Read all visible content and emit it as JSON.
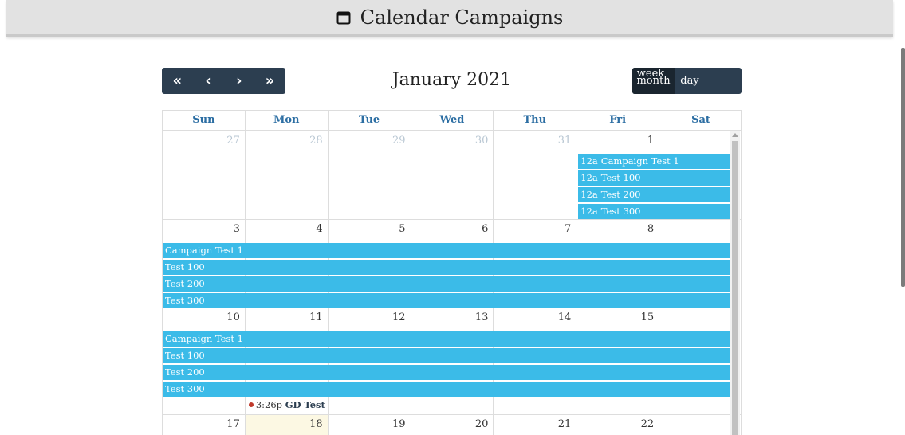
{
  "header": {
    "title": "Calendar Campaigns",
    "icon": "calendar-icon"
  },
  "toolbar": {
    "nav": [
      {
        "label": "«",
        "name": "prev-year-button"
      },
      {
        "label": "‹",
        "name": "prev-month-button"
      },
      {
        "label": "›",
        "name": "next-month-button"
      },
      {
        "label": "»",
        "name": "next-year-button"
      }
    ],
    "title": "January 2021",
    "views": [
      {
        "label": "month",
        "name": "month-view-button",
        "active": true
      },
      {
        "label": "week",
        "name": "week-view-button",
        "active": false
      },
      {
        "label": "day",
        "name": "day-view-button",
        "active": false
      }
    ]
  },
  "calendar": {
    "weekdays": [
      "Sun",
      "Mon",
      "Tue",
      "Wed",
      "Thu",
      "Fri",
      "Sat"
    ],
    "weeks": [
      {
        "days": [
          {
            "num": "27",
            "other": true
          },
          {
            "num": "28",
            "other": true
          },
          {
            "num": "29",
            "other": true
          },
          {
            "num": "30",
            "other": true
          },
          {
            "num": "31",
            "other": true
          },
          {
            "num": "1",
            "other": false
          },
          {
            "num": "",
            "other": false
          }
        ],
        "events": [
          {
            "time": "12a",
            "title": "Campaign Test 1",
            "startCol": 5,
            "span": 2
          },
          {
            "time": "12a",
            "title": "Test 100",
            "startCol": 5,
            "span": 2
          },
          {
            "time": "12a",
            "title": "Test 200",
            "startCol": 5,
            "span": 2
          },
          {
            "time": "12a",
            "title": "Test 300",
            "startCol": 5,
            "span": 2
          }
        ],
        "dotEvents": []
      },
      {
        "days": [
          {
            "num": "3",
            "other": false
          },
          {
            "num": "4",
            "other": false
          },
          {
            "num": "5",
            "other": false
          },
          {
            "num": "6",
            "other": false
          },
          {
            "num": "7",
            "other": false
          },
          {
            "num": "8",
            "other": false
          },
          {
            "num": "",
            "other": false
          }
        ],
        "events": [
          {
            "time": "",
            "title": "Campaign Test 1",
            "startCol": 0,
            "span": 7
          },
          {
            "time": "",
            "title": "Test 100",
            "startCol": 0,
            "span": 7
          },
          {
            "time": "",
            "title": "Test 200",
            "startCol": 0,
            "span": 7
          },
          {
            "time": "",
            "title": "Test 300",
            "startCol": 0,
            "span": 7
          }
        ],
        "dotEvents": []
      },
      {
        "days": [
          {
            "num": "10",
            "other": false
          },
          {
            "num": "11",
            "other": false
          },
          {
            "num": "12",
            "other": false
          },
          {
            "num": "13",
            "other": false
          },
          {
            "num": "14",
            "other": false
          },
          {
            "num": "15",
            "other": false
          },
          {
            "num": "",
            "other": false
          }
        ],
        "events": [
          {
            "time": "",
            "title": "Campaign Test 1",
            "startCol": 0,
            "span": 7
          },
          {
            "time": "",
            "title": "Test 100",
            "startCol": 0,
            "span": 7
          },
          {
            "time": "",
            "title": "Test 200",
            "startCol": 0,
            "span": 7
          },
          {
            "time": "",
            "title": "Test 300",
            "startCol": 0,
            "span": 7
          }
        ],
        "dotEvents": [
          {
            "time": "3:26p",
            "title": "GD Test Ca",
            "col": 1
          }
        ]
      },
      {
        "days": [
          {
            "num": "17",
            "other": false
          },
          {
            "num": "18",
            "other": false,
            "today": true
          },
          {
            "num": "19",
            "other": false
          },
          {
            "num": "20",
            "other": false
          },
          {
            "num": "21",
            "other": false
          },
          {
            "num": "22",
            "other": false
          },
          {
            "num": "",
            "other": false
          }
        ],
        "events": [],
        "dotEvents": []
      }
    ]
  },
  "colors": {
    "event": "#3bbbe8",
    "toolbar": "#2c3e50",
    "today": "#fcf8e3",
    "dot": "#c0392b"
  }
}
